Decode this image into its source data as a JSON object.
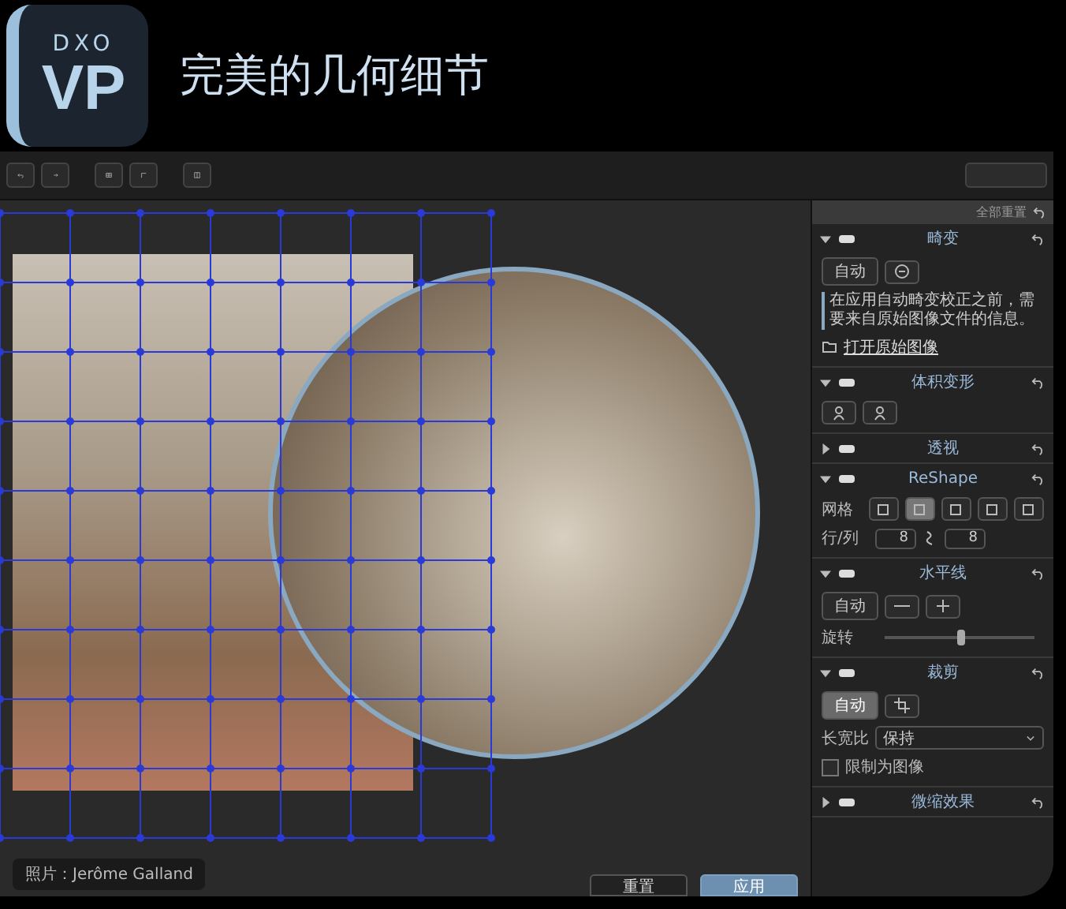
{
  "header": {
    "logo_top": "DXO",
    "logo_main": "VP",
    "title": "完美的几何细节"
  },
  "canvas": {
    "caption": "照片：Jerôme Galland"
  },
  "panel": {
    "reset_all": "全部重置",
    "sections": [
      {
        "kind": "distortion",
        "title": "畸变",
        "expanded": true,
        "auto": "自动",
        "message": "在应用自动畸变校正之前，需要来自原始图像文件的信息。",
        "link": "打开原始图像"
      },
      {
        "kind": "volume",
        "title": "体积变形",
        "expanded": true
      },
      {
        "kind": "plain",
        "title": "透视",
        "expanded": false
      },
      {
        "kind": "reshape",
        "title": "ReShape",
        "expanded": true,
        "grid_label": "网格",
        "grid_options": [
          {
            "selected": false
          },
          {
            "selected": true
          },
          {
            "selected": false
          },
          {
            "selected": false
          },
          {
            "selected": false
          }
        ],
        "rows_label": "行/列",
        "rows": "8",
        "cols": "8"
      },
      {
        "kind": "horizon",
        "title": "水平线",
        "expanded": true,
        "auto": "自动",
        "rotation_label": "旋转",
        "level": 0.5
      },
      {
        "kind": "crop",
        "title": "裁剪",
        "expanded": true,
        "auto": "自动",
        "aspect_label": "长宽比",
        "aspect_value": "保持",
        "constrain_label": "限制为图像",
        "checked": false
      },
      {
        "kind": "plain",
        "title": "微缩效果",
        "expanded": false
      }
    ]
  },
  "footer": {
    "buttons": [
      {
        "label": "重置",
        "primary": false
      },
      {
        "label": "应用",
        "primary": true
      }
    ]
  }
}
